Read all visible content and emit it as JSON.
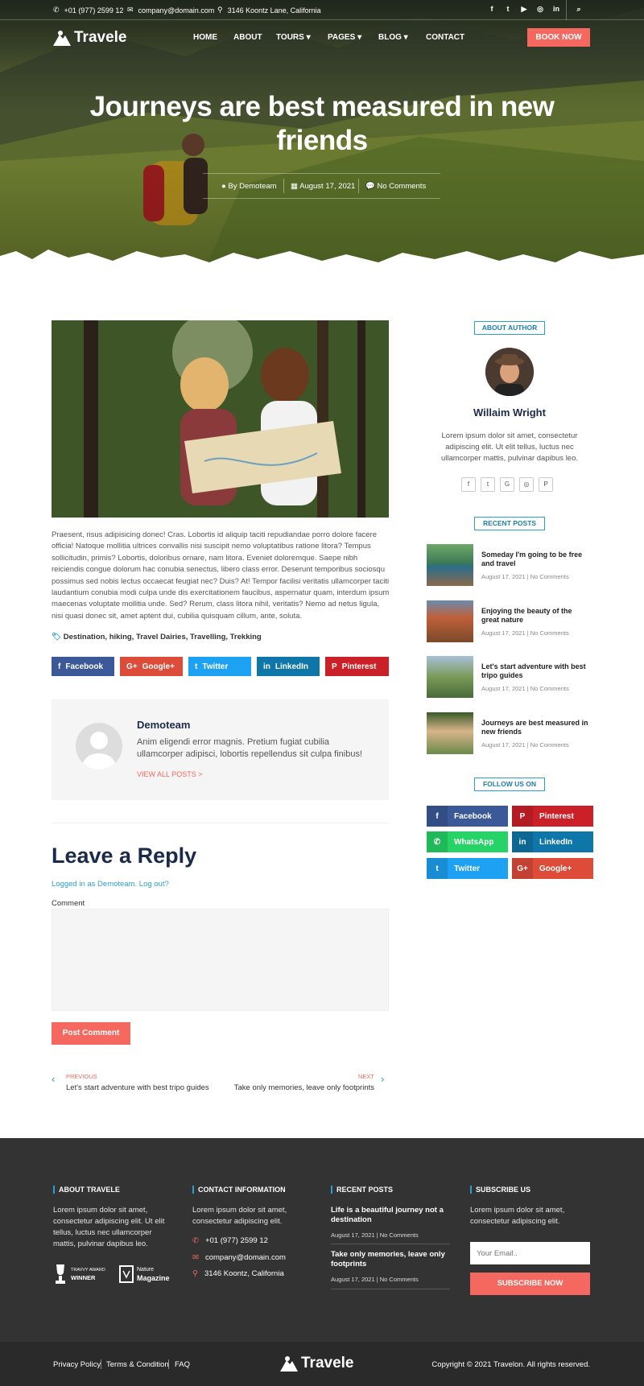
{
  "topbar": {
    "phone": "+01 (977) 2599 12",
    "email": "company@domain.com",
    "address": "3146 Koontz Lane, California",
    "social_icons": [
      "facebook-icon",
      "twitter-icon",
      "youtube-icon",
      "instagram-icon",
      "linkedin-icon"
    ],
    "search_icon": "search-icon"
  },
  "header": {
    "logo_text": "Travele",
    "nav": [
      "HOME",
      "ABOUT",
      "TOURS",
      "PAGES",
      "BLOG",
      "CONTACT"
    ],
    "book_now": "BOOK NOW"
  },
  "hero": {
    "title": "Journeys are best measured in new friends",
    "author": "By Demoteam",
    "date": "August 17, 2021",
    "comments": "No Comments"
  },
  "article": {
    "body": "Praesent, risus adipisicing donec! Cras. Lobortis id aliquip taciti repudiandae porro dolore facere officia! Natoque mollitia ultrices convallis nisi suscipit nemo voluptatibus ratione litora? Tempus sollicitudin, primis? Lobortis, doloribus ornare, nam litora. Eveniet doloremque. Saepe nibh reiciendis congue dolorum hac conubia senectus, libero class error. Deserunt temporibus sociosqu possimus sed nobis lectus occaecat feugiat nec? Duis? At! Tempor facilisi veritatis ullamcorper taciti laudantium conubia modi culpa unde dis exercitationem faucibus, aspernatur quam, interdum ipsum maecenas voluptate mollitia unde. Sed? Rerum, class litora nihil, veritatis? Nemo ad netus ligula, nisi quasi donec sit, amet aptent dui, cubilia quisquam cillum, ante, soluta.",
    "tags": "Destination, hiking, Travel Dairies, Travelling, Trekking",
    "share": [
      "Facebook",
      "Google+",
      "Twitter",
      "LinkedIn",
      "Pinterest"
    ]
  },
  "author_box": {
    "name": "Demoteam",
    "bio": "Anim eligendi error magnis. Pretium fugiat cubilia ullamcorper adipisci, lobortis repellendus sit culpa finibus!",
    "view_all": "VIEW ALL POSTS >"
  },
  "reply": {
    "heading": "Leave a Reply",
    "logged_in": "Logged in as Demoteam. Log out?",
    "comment_label": "Comment",
    "comment_value": "",
    "submit": "Post Comment"
  },
  "post_nav": {
    "prev_label": "PREVIOUS",
    "prev_title": "Let's start adventure with best tripo guides",
    "next_label": "NEXT",
    "next_title": "Take only memories, leave only footprints"
  },
  "sidebar": {
    "about_label": "ABOUT AUTHOR",
    "author_name": "Willaim Wright",
    "author_bio": "Lorem ipsum dolor sit amet, consectetur adipiscing elit. Ut elit tellus, luctus nec ullamcorper mattis, pulvinar dapibus leo.",
    "author_social": [
      "facebook-icon",
      "twitter-icon",
      "google-icon",
      "instagram-icon",
      "pinterest-icon"
    ],
    "recent_label": "RECENT POSTS",
    "recent_posts": [
      {
        "title": "Someday I'm going to be free and travel",
        "date": "August 17, 2021",
        "comments": "No Comments"
      },
      {
        "title": "Enjoying the beauty of the great nature",
        "date": "August 17, 2021",
        "comments": "No Comments"
      },
      {
        "title": "Let's start adventure with best tripo guides",
        "date": "August 17, 2021",
        "comments": "No Comments"
      },
      {
        "title": "Journeys are best measured in new friends",
        "date": "August 17, 2021",
        "comments": "No Comments"
      }
    ],
    "follow_label": "FOLLOW US ON",
    "follow": [
      {
        "label": "Facebook",
        "color": "#3b5998",
        "icon": "facebook-icon"
      },
      {
        "label": "Pinterest",
        "color": "#cb2027",
        "icon": "pinterest-icon"
      },
      {
        "label": "WhatsApp",
        "color": "#25d366",
        "icon": "whatsapp-icon"
      },
      {
        "label": "LinkedIn",
        "color": "#0e76a8",
        "icon": "linkedin-icon"
      },
      {
        "label": "Twitter",
        "color": "#1da1f2",
        "icon": "twitter-icon"
      },
      {
        "label": "Google+",
        "color": "#dd4b39",
        "icon": "googleplus-icon"
      }
    ]
  },
  "footer": {
    "about_head": "ABOUT TRAVELE",
    "about_text": "Lorem ipsum dolor sit amet, consectetur adipiscing elit. Ut elit tellus, luctus nec ullamcorper mattis, pulvinar dapibus leo.",
    "award1_top": "TRAVVY AWARD",
    "award1_bottom": "WINNER",
    "award2_top": "Nature",
    "award2_bottom": "Magazine",
    "contact_head": "CONTACT INFORMATION",
    "contact_text": "Lorem ipsum dolor sit amet, consectetur adipiscing elit.",
    "phone": "+01 (977) 2599 12",
    "email": "company@domain.com",
    "address": "3146 Koontz, California",
    "recent_head": "RECENT POSTS",
    "recent": [
      {
        "title": "Life is a beautiful journey not a destination",
        "date": "August 17, 2021",
        "comments": "No Comments"
      },
      {
        "title": "Take only memories, leave only footprints",
        "date": "August 17, 2021",
        "comments": "No Comments"
      }
    ],
    "subscribe_head": "SUBSCRIBE US",
    "subscribe_text": "Lorem ipsum dolor sit amet, consectetur adipiscing elit.",
    "email_placeholder": "Your Email..",
    "subscribe_btn": "SUBSCRIBE NOW",
    "links": [
      "Privacy Policy",
      "Terms & Condition",
      "FAQ"
    ],
    "logo_text": "Travele",
    "copyright": "Copyright © 2021 Travelon. All rights reserved."
  },
  "colors": {
    "accent": "#f56860",
    "blue": "#2a9fd0",
    "navy": "#1b2a4a",
    "footer": "#333334"
  }
}
